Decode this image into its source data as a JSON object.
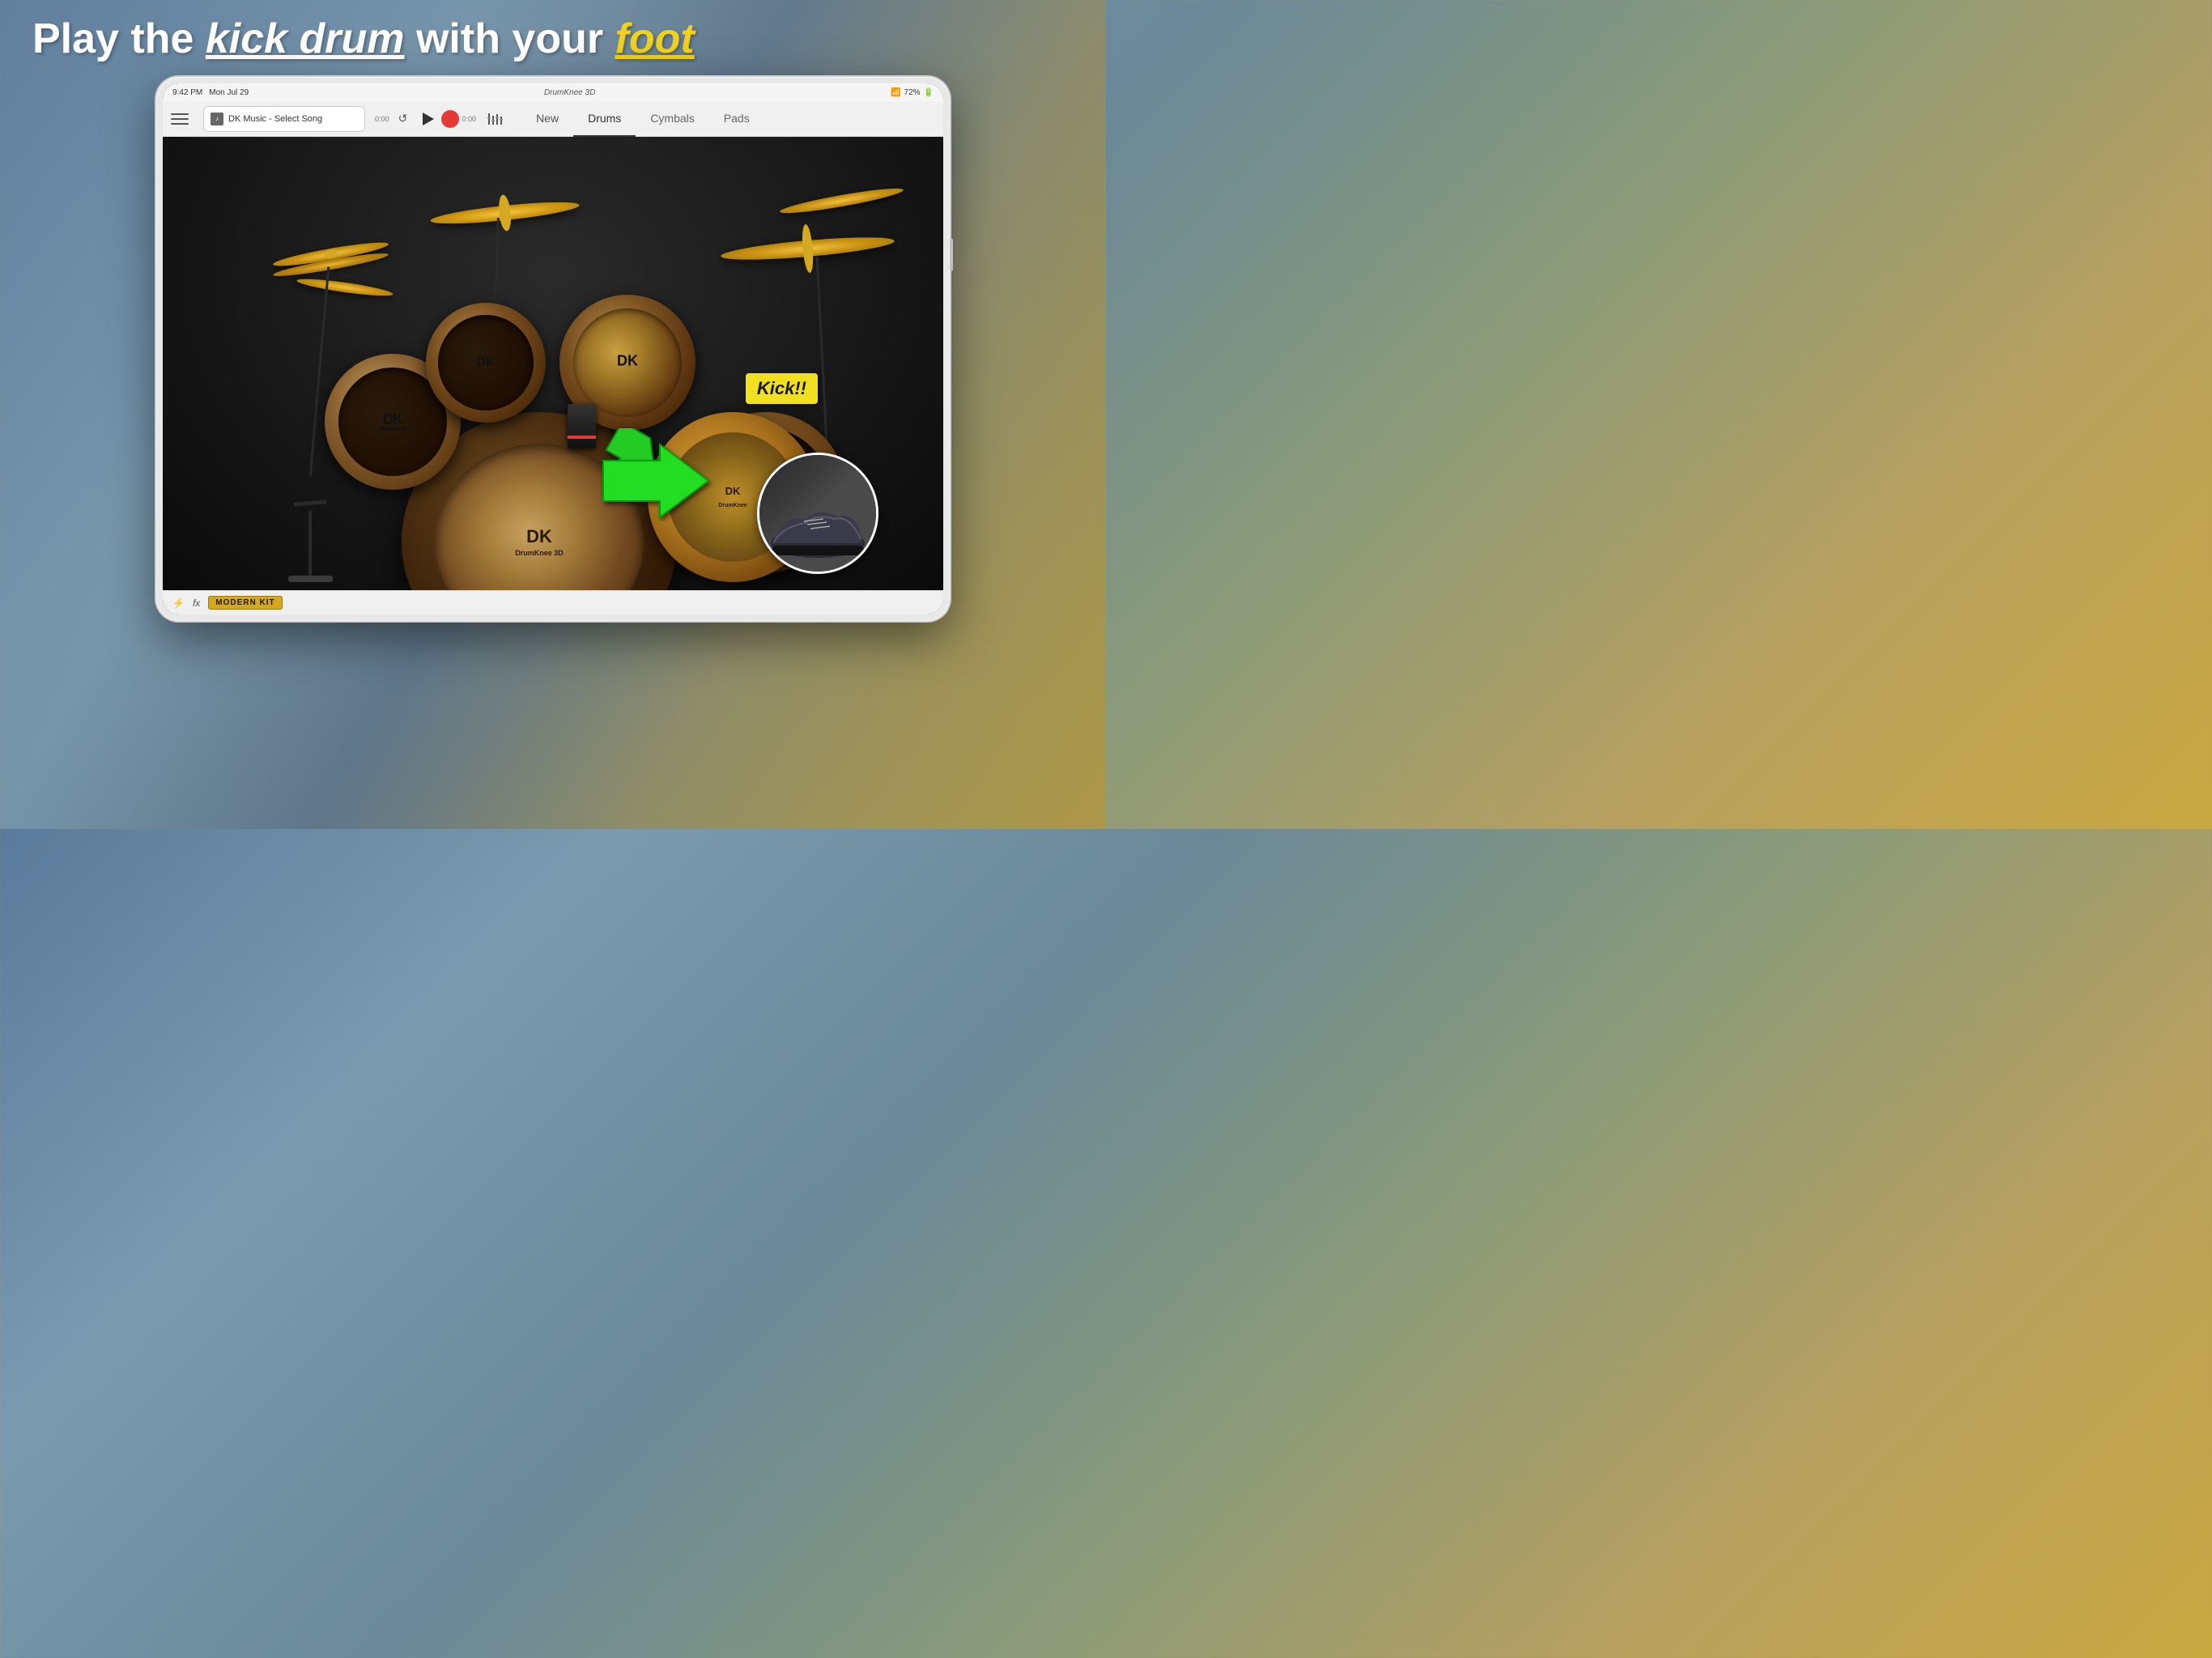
{
  "headline": {
    "prefix": "Play the ",
    "highlight1": "kick drum",
    "middle": " with your ",
    "highlight2": "foot"
  },
  "status_bar": {
    "time": "9:42 PM",
    "date": "Mon Jul 29",
    "app_title": "DrumKnee 3D",
    "wifi": "WiFi",
    "battery": "72%"
  },
  "toolbar": {
    "menu_label": "Menu",
    "song_title": "DK Music - Select Song",
    "time_current": "0:00",
    "time_total": "0:00",
    "refresh_label": "Refresh",
    "play_label": "Play",
    "record_label": "Record",
    "mixer_label": "Mixer",
    "tabs": [
      {
        "label": "New",
        "active": false
      },
      {
        "label": "Drums",
        "active": true
      },
      {
        "label": "Cymbals",
        "active": false
      },
      {
        "label": "Pads",
        "active": false
      }
    ]
  },
  "drum_kit": {
    "label": "DK",
    "sub_label": "DrumKnee 3D",
    "kit_name": "MODERN KIT"
  },
  "kick_overlay": {
    "label": "Kick!!",
    "arrow_color": "#22cc22",
    "label_bg": "#f0e020"
  },
  "bottom_bar": {
    "bluetooth_icon": "bluetooth",
    "fx_label": "fx",
    "kit_badge": "MODERN KIT"
  }
}
